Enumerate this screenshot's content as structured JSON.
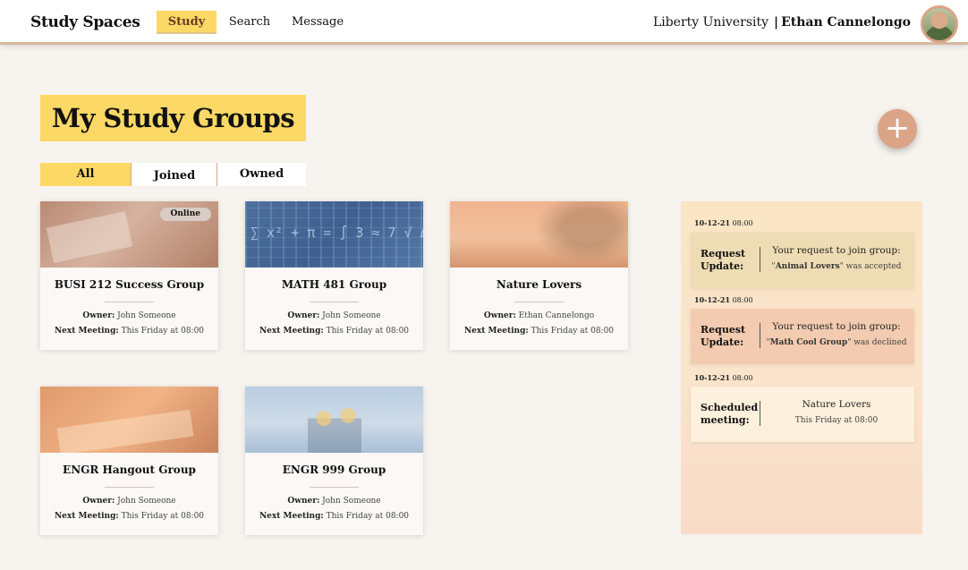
{
  "app": {
    "brand": "Study Spaces",
    "nav": [
      {
        "label": "Study",
        "active": true
      },
      {
        "label": "Search",
        "active": false
      },
      {
        "label": "Message",
        "active": false
      }
    ],
    "university": "Liberty University",
    "separator": "|",
    "user_name": "Ethan Cannelongo"
  },
  "page": {
    "title": "My Study Groups",
    "add_icon": "plus-icon",
    "add_symbol": "+",
    "filters": [
      {
        "label": "All",
        "active": true
      },
      {
        "label": "Joined",
        "active": false
      },
      {
        "label": "Owned",
        "active": false
      }
    ]
  },
  "groups": [
    {
      "title": "BUSI 212 Success Group",
      "badge": "Online",
      "owner_label": "Owner:",
      "owner": "John Someone",
      "meeting_label": "Next Meeting:",
      "meeting": "This Friday at  08:00"
    },
    {
      "title": "MATH 481 Group",
      "badge": "",
      "owner_label": "Owner:",
      "owner": "John Someone",
      "meeting_label": "Next Meeting:",
      "meeting": "This Friday at  08:00"
    },
    {
      "title": "Nature Lovers",
      "badge": "",
      "owner_label": "Owner:",
      "owner": "Ethan Cannelongo",
      "meeting_label": "Next Meeting:",
      "meeting": "This Friday at  08:00"
    },
    {
      "title": "ENGR Hangout Group",
      "badge": "",
      "owner_label": "Owner:",
      "owner": "John Someone",
      "meeting_label": "Next Meeting:",
      "meeting": "This Friday at  08:00"
    },
    {
      "title": "ENGR 999 Group",
      "badge": "",
      "owner_label": "Owner:",
      "owner": "John Someone",
      "meeting_label": "Next Meeting:",
      "meeting": "This Friday at  08:00"
    }
  ],
  "notifications": [
    {
      "date": "10-12-21",
      "time": "08:00",
      "kind": "Request Update:",
      "line1": "Your request to join group:",
      "group": "Animal Lovers",
      "suffix": " was accepted",
      "color": "#eedcb4"
    },
    {
      "date": "10-12-21",
      "time": "08:00",
      "kind": "Request Update:",
      "line1": "Your request to join group:",
      "group": "Math  Cool Group",
      "suffix": " was declined",
      "color": "#f2cbb0"
    },
    {
      "date": "10-12-21",
      "time": "08:00",
      "kind": "Scheduled meeting:",
      "line1": "Nature Lovers",
      "group": "",
      "suffix": "This Friday at 08:00",
      "color": "#fdf0dc"
    }
  ],
  "colors": {
    "accent_yellow": "#fcd866",
    "accent_peach": "#dba487",
    "background": "#f7f3ee"
  }
}
